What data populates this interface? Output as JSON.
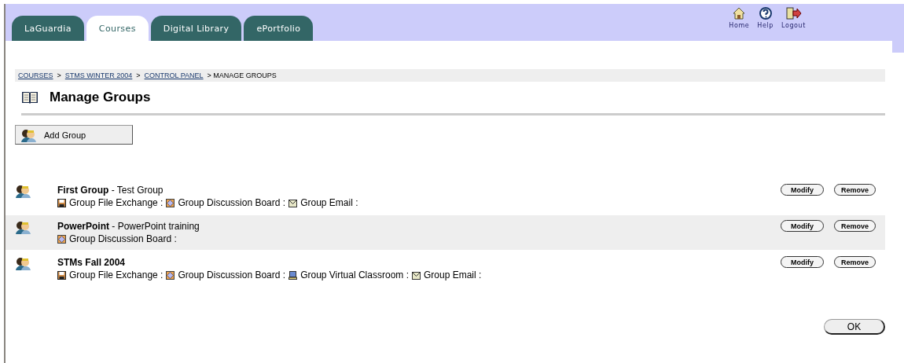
{
  "tabs": [
    {
      "label": "LaGuardia",
      "selected": false
    },
    {
      "label": "Courses",
      "selected": true
    },
    {
      "label": "Digital Library",
      "selected": false
    },
    {
      "label": "ePortfolio",
      "selected": false
    }
  ],
  "top_links": [
    {
      "kind": "home",
      "label": "Home"
    },
    {
      "kind": "help",
      "label": "Help"
    },
    {
      "kind": "logout",
      "label": "Logout"
    }
  ],
  "breadcrumb": [
    {
      "label": "COURSES",
      "link": true
    },
    {
      "label": "> ",
      "link": false
    },
    {
      "label": "STMS  WINTER 2004",
      "link": true
    },
    {
      "label": "> ",
      "link": false
    },
    {
      "label": "CONTROL PANEL",
      "link": true
    },
    {
      "label": "> MANAGE GROUPS",
      "link": false
    }
  ],
  "title": "Manage Groups",
  "add_button": "Add Group",
  "groups": [
    {
      "name": "First Group",
      "description": " - Test Group",
      "tools": [
        {
          "kind": "file",
          "label": "Group File Exchange :"
        },
        {
          "kind": "discussion",
          "label": "Group Discussion Board :"
        },
        {
          "kind": "email",
          "label": "Group Email :"
        }
      ],
      "actions": [
        "Modify",
        "Remove"
      ]
    },
    {
      "name": "PowerPoint",
      "description": " - PowerPoint training",
      "tools": [
        {
          "kind": "discussion",
          "label": "Group Discussion Board :"
        }
      ],
      "actions": [
        "Modify",
        "Remove"
      ]
    },
    {
      "name": "STMs Fall 2004",
      "tools": [
        {
          "kind": "file",
          "label": "Group File Exchange :"
        },
        {
          "kind": "discussion",
          "label": "Group Discussion Board :"
        },
        {
          "kind": "classroom",
          "label": "Group Virtual Classroom :"
        },
        {
          "kind": "email",
          "label": "Group Email :"
        }
      ],
      "actions": [
        "Modify",
        "Remove"
      ]
    }
  ],
  "ok_button": "OK"
}
